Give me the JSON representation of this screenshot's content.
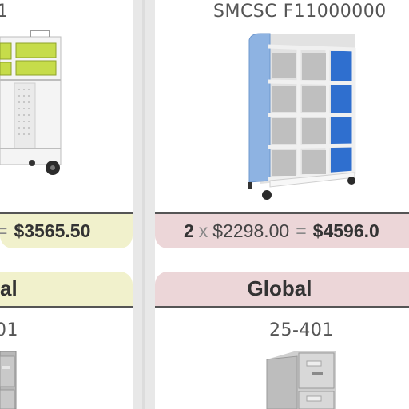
{
  "left_card": {
    "code": "1",
    "price_equals": "=",
    "total": "$3565.50",
    "category": "al",
    "sub_code": "01",
    "accent": "#f1f1cc"
  },
  "right_card": {
    "code": "SMCSC F11000000",
    "quantity": "2",
    "times": "x",
    "unit_price": "$2298.00",
    "equals": "=",
    "total": "$4596.0",
    "category": "Global",
    "sub_code": "25-401",
    "accent": "#ecd6d8"
  },
  "icons": {
    "left_product": "mobile-cart-with-green-bins-image",
    "right_product": "blue-cubby-storage-unit-image",
    "left_cabinet": "gray-file-cabinet-image",
    "right_cabinet": "gray-file-cabinet-image"
  }
}
